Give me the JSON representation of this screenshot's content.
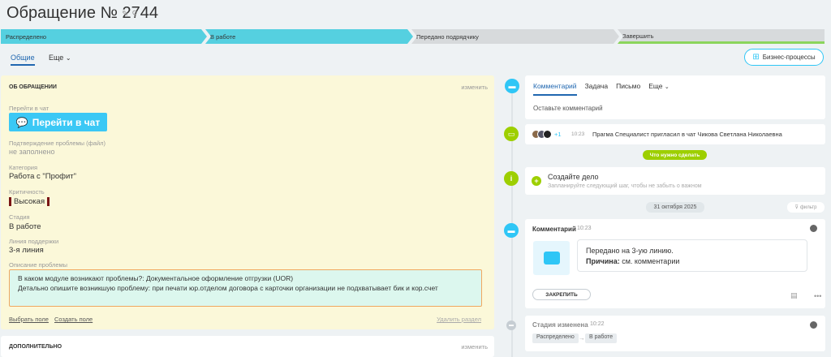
{
  "header": {
    "title": "Обращение № 2744",
    "icons": [
      "pencil-icon",
      "paperclip-icon"
    ]
  },
  "stages": [
    {
      "label": "Распределено",
      "state": "active"
    },
    {
      "label": "В работе",
      "state": "active"
    },
    {
      "label": "Передано подрядчику",
      "state": "inactive"
    },
    {
      "label": "Завершить",
      "state": "final"
    }
  ],
  "colors": {
    "stage_active": "#55d0e0",
    "stage_inactive": "#d7dadc",
    "final_accent": "#8bd55c",
    "accent_blue": "#2067b0",
    "chat_button": "#3bc8f5",
    "todo_green": "#9dcf00",
    "priority_mark": "#7a1515"
  },
  "tabs": {
    "general": "Общие",
    "more": "Еще"
  },
  "business_processes_label": "Бизнес-процессы",
  "about": {
    "section_title": "ОБ ОБРАЩЕНИИ",
    "edit_label": "изменить",
    "chat_label": "Перейти в чат",
    "chat_button": "Перейти в чат",
    "confirmation_label": "Подтверждение проблемы (файл)",
    "confirmation_value": "не заполнено",
    "category_label": "Категория",
    "category_value": "Работа с \"Профит\"",
    "priority_label": "Критичность",
    "priority_value": "Высокая",
    "stage_label": "Стадия",
    "stage_value": "В работе",
    "support_line_label": "Линия поддержки",
    "support_line_value": "3-я линия",
    "description_label": "Описание проблемы",
    "description_line1": "В каком модуле возникают проблемы?: Документальное оформление отгрузки (UOR)",
    "description_line2": "Детально опишите возникшую проблему: при печати юр.отделом договора с карточки организации не подхватывает бик и кор.счет",
    "select_field": "Выбрать поле",
    "create_field": "Создать поле",
    "delete_section": "Удалить раздел"
  },
  "extra": {
    "section_title": "ДОПОЛНИТЕЛЬНО",
    "edit_label": "изменить"
  },
  "editor": {
    "tabs": [
      "Комментарий",
      "Задача",
      "Письмо",
      "Еще"
    ],
    "placeholder": "Оставьте комментарий"
  },
  "chat_event": {
    "plus_count": "+1",
    "time": "10:23",
    "text": "Прагма Специалист пригласил в чат Чикова Светлана Николаевна"
  },
  "todo_pill": "Что нужно сделать",
  "todo": {
    "title": "Создайте дело",
    "subtitle": "Запланируйте следующий шаг, чтобы не забыть о важном"
  },
  "date_separator": "31 октября 2025",
  "filter_label": "фильтр",
  "comment": {
    "title": "Комментарий",
    "time": "10:23",
    "line1": "Передано на 3-ую линию.",
    "line2_bold": "Причина:",
    "line2_rest": " см. комментарии",
    "pin_label": "ЗАКРЕПИТЬ"
  },
  "stage_change": {
    "title": "Стадия изменена",
    "time": "10:22",
    "from": "Распределено",
    "to": "В работе"
  }
}
